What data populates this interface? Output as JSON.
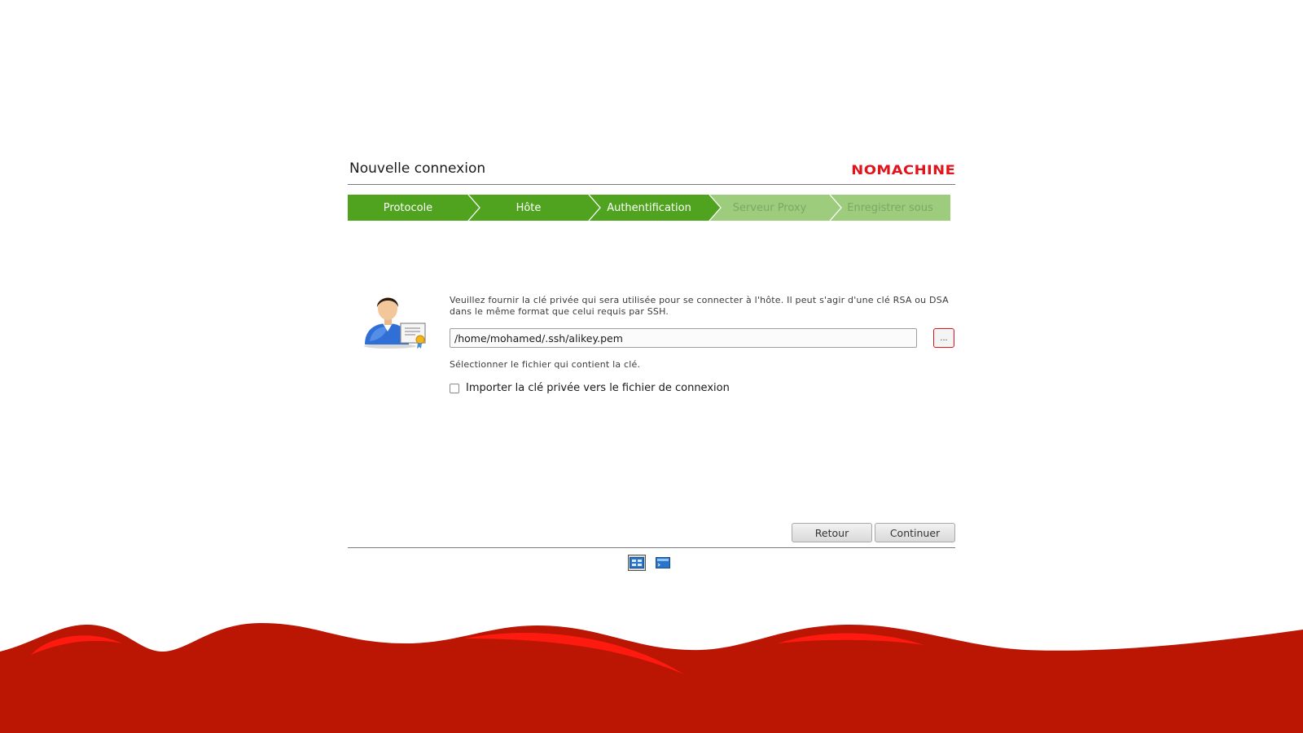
{
  "header": {
    "title": "Nouvelle connexion",
    "logo_text": "NOMACHINE"
  },
  "steps": [
    {
      "label": "Protocole",
      "state": "done"
    },
    {
      "label": "Hôte",
      "state": "done"
    },
    {
      "label": "Authentification",
      "state": "current"
    },
    {
      "label": "Serveur Proxy",
      "state": "pending"
    },
    {
      "label": "Enregistrer sous",
      "state": "pending"
    }
  ],
  "auth": {
    "description": "Veuillez fournir la clé privée qui sera utilisée pour se connecter à l'hôte. Il peut s'agir d'une clé RSA ou DSA dans le même format que celui requis par SSH.",
    "key_path": "/home/mohamed/.ssh/alikey.pem",
    "browse_label": "...",
    "hint": "Sélectionner le fichier qui contient la clé.",
    "import_label": "Importer la clé privée vers le fichier de connexion",
    "import_checked": false
  },
  "buttons": {
    "back": "Retour",
    "continue": "Continuer"
  },
  "view_modes": [
    {
      "icon": "grid-view-icon",
      "selected": true
    },
    {
      "icon": "list-view-icon",
      "selected": false
    }
  ],
  "colors": {
    "accent_red": "#e0141a",
    "step_active": "#4fa31e",
    "step_inactive": "#9ccc7c",
    "wave_red": "#bb1503"
  }
}
